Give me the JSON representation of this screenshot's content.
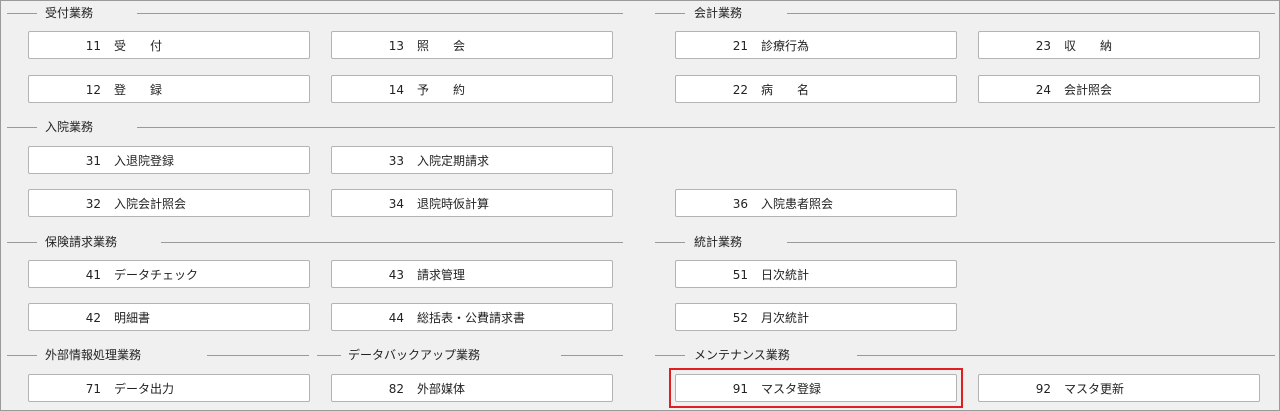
{
  "sections": {
    "uketsuke": "受付業務",
    "kaikei": "会計業務",
    "nyuin": "入院業務",
    "hoken": "保険請求業務",
    "toukei": "統計業務",
    "gaibu": "外部情報処理業務",
    "backup": "データバックアップ業務",
    "maintenance": "メンテナンス業務"
  },
  "buttons": {
    "b11": {
      "num": "11",
      "label": "受　　付"
    },
    "b12": {
      "num": "12",
      "label": "登　　録"
    },
    "b13": {
      "num": "13",
      "label": "照　　会"
    },
    "b14": {
      "num": "14",
      "label": "予　　約"
    },
    "b21": {
      "num": "21",
      "label": "診療行為"
    },
    "b22": {
      "num": "22",
      "label": "病　　名"
    },
    "b23": {
      "num": "23",
      "label": "収　　納"
    },
    "b24": {
      "num": "24",
      "label": "会計照会"
    },
    "b31": {
      "num": "31",
      "label": "入退院登録"
    },
    "b32": {
      "num": "32",
      "label": "入院会計照会"
    },
    "b33": {
      "num": "33",
      "label": "入院定期請求"
    },
    "b34": {
      "num": "34",
      "label": "退院時仮計算"
    },
    "b36": {
      "num": "36",
      "label": "入院患者照会"
    },
    "b41": {
      "num": "41",
      "label": "データチェック"
    },
    "b42": {
      "num": "42",
      "label": "明細書"
    },
    "b43": {
      "num": "43",
      "label": "請求管理"
    },
    "b44": {
      "num": "44",
      "label": "総括表・公費請求書"
    },
    "b51": {
      "num": "51",
      "label": "日次統計"
    },
    "b52": {
      "num": "52",
      "label": "月次統計"
    },
    "b71": {
      "num": "71",
      "label": "データ出力"
    },
    "b82": {
      "num": "82",
      "label": "外部媒体"
    },
    "b91": {
      "num": "91",
      "label": "マスタ登録"
    },
    "b92": {
      "num": "92",
      "label": "マスタ更新"
    }
  },
  "highlight": {
    "target": "91",
    "color": "#e02020"
  }
}
